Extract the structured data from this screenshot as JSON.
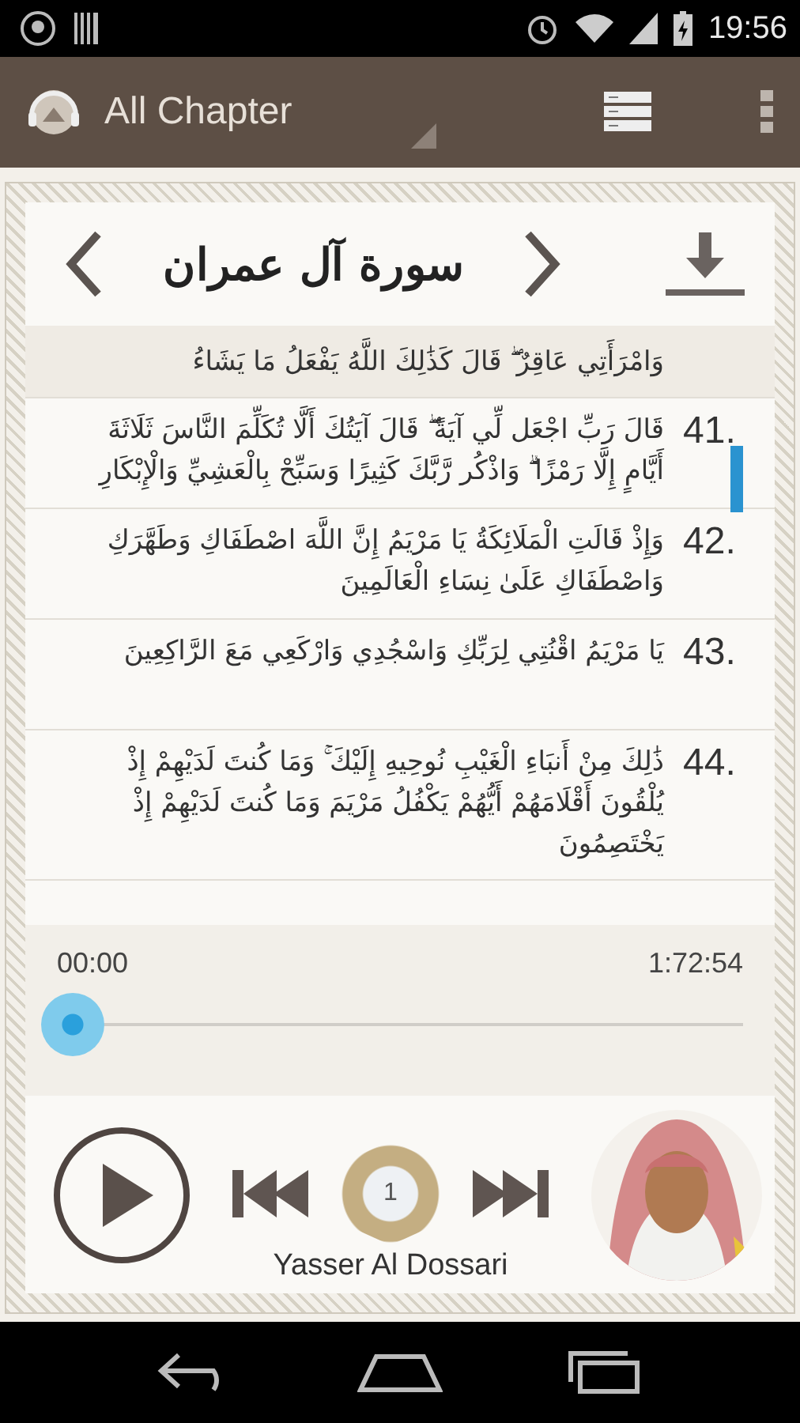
{
  "status_bar": {
    "time": "19:56"
  },
  "app_bar": {
    "title": "All Chapter"
  },
  "surah": {
    "title": "سورة آل عمران"
  },
  "verses": [
    {
      "text": "وَامْرَأَتِي عَاقِرٌ ۖ قَالَ كَذَٰلِكَ اللَّهُ يَفْعَلُ مَا يَشَاءُ",
      "highlighted": true
    },
    {
      "number": "41.",
      "text": "قَالَ رَبِّ اجْعَل لِّي آيَةً ۖ قَالَ آيَتُكَ أَلَّا تُكَلِّمَ النَّاسَ ثَلَاثَةَ أَيَّامٍ إِلَّا رَمْزًا ۗ وَاذْكُر رَّبَّكَ كَثِيرًا وَسَبِّحْ بِالْعَشِيِّ وَالْإِبْكَارِ",
      "highlighted": false
    },
    {
      "number": "42.",
      "text": "وَإِذْ قَالَتِ الْمَلَائِكَةُ يَا مَرْيَمُ إِنَّ اللَّهَ اصْطَفَاكِ وَطَهَّرَكِ وَاصْطَفَاكِ عَلَىٰ نِسَاءِ الْعَالَمِينَ",
      "highlighted": false
    },
    {
      "number": "43.",
      "text": "يَا مَرْيَمُ اقْنُتِي لِرَبِّكِ وَاسْجُدِي وَارْكَعِي مَعَ الرَّاكِعِينَ",
      "highlighted": false
    },
    {
      "number": "44.",
      "text": "ذَٰلِكَ مِنْ أَنبَاءِ الْغَيْبِ نُوحِيهِ إِلَيْكَ ۚ وَمَا كُنتَ لَدَيْهِمْ إِذْ يُلْقُونَ أَقْلَامَهُمْ أَيُّهُمْ يَكْفُلُ مَرْيَمَ وَمَا كُنتَ لَدَيْهِمْ إِذْ يَخْتَصِمُونَ",
      "highlighted": false
    }
  ],
  "player": {
    "elapsed": "00:00",
    "duration": "1:72:54",
    "level": 0,
    "playing": false,
    "track_number": "1",
    "reciter": "Yasser Al Dossari"
  }
}
